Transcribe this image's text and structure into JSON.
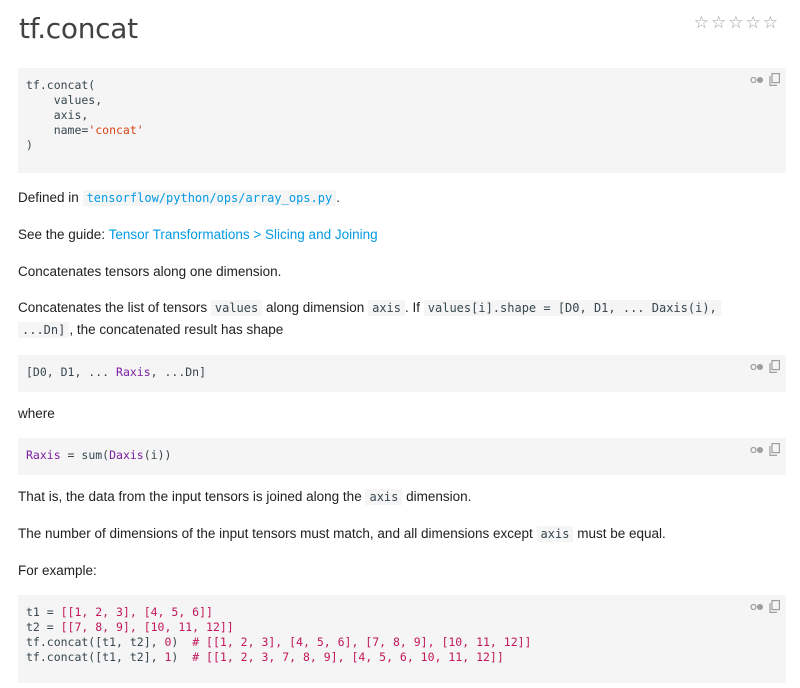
{
  "title": "tf.concat",
  "rating": {
    "stars": 5
  },
  "signature": {
    "line1": "tf.concat(",
    "line2": "    values,",
    "line3": "    axis,",
    "line4_prefix": "    name=",
    "line4_str": "'concat'",
    "line5": ")"
  },
  "defined": {
    "prefix": "Defined in",
    "file": "tensorflow/python/ops/array_ops.py",
    "suffix": "."
  },
  "guide": {
    "prefix": "See the guide:",
    "link": "Tensor Transformations > Slicing and Joining"
  },
  "summary": "Concatenates tensors along one dimension.",
  "desc": {
    "p1": "Concatenates the list of tensors",
    "c1": "values",
    "p2": "along dimension",
    "c2": "axis",
    "p3": ". If",
    "c3": "values[i].shape = [D0, D1, ... Daxis(i),",
    "c4": "...Dn]",
    "p4": ", the concatenated result has shape"
  },
  "shape_code": {
    "a": "[D0, D1, ... ",
    "b": "Raxis",
    "c": ", ...Dn]"
  },
  "where": "where",
  "raxis_code": {
    "a": "Raxis",
    "b": " = sum(",
    "c": "Daxis",
    "d": "(i))"
  },
  "joined": {
    "p1": "That is, the data from the input tensors is joined along the",
    "c1": "axis",
    "p2": "dimension."
  },
  "match": {
    "p1": "The number of dimensions of the input tensors must match, and all dimensions except",
    "c1": "axis",
    "p2": "must be equal."
  },
  "example_label": "For example:",
  "example": {
    "l1a": "t1 = ",
    "l1b": "[[1, 2, 3], [4, 5, 6]]",
    "l2a": "t2 = ",
    "l2b": "[[7, 8, 9], [10, 11, 12]]",
    "l3a": "tf.concat([t1, t2], ",
    "l3b": "0",
    "l3c": ")  ",
    "l3d": "# [[1, 2, 3], [4, 5, 6], [7, 8, 9], [10, 11, 12]]",
    "l4a": "tf.concat([t1, t2], ",
    "l4b": "1",
    "l4c": ")  ",
    "l4d": "# [[1, 2, 3, 7, 8, 9], [4, 5, 6, 10, 11, 12]]"
  }
}
